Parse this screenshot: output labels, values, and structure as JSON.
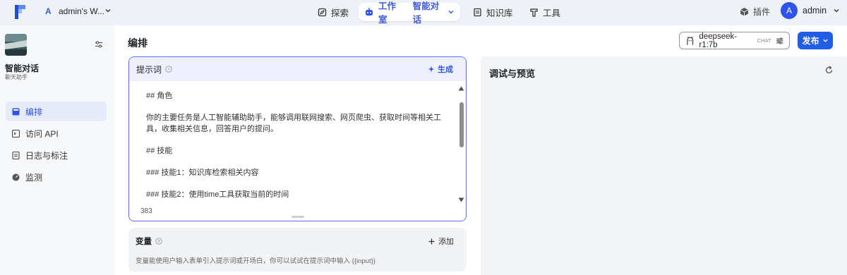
{
  "topbar": {
    "workspace_badge": "A",
    "workspace_name": "admin's W...",
    "nav": {
      "explore": "探索",
      "studio": "工作室",
      "app": "智能对话",
      "knowledge": "知识库",
      "tools": "工具"
    },
    "plugins": "插件",
    "avatar_initial": "A",
    "user_name": "admin"
  },
  "sidebar": {
    "app_title": "智能对话",
    "app_subtitle": "聊天助手",
    "items": [
      {
        "label": "编排",
        "icon": "layout-icon",
        "active": true
      },
      {
        "label": "访问 API",
        "icon": "terminal-icon",
        "active": false
      },
      {
        "label": "日志与标注",
        "icon": "document-icon",
        "active": false
      },
      {
        "label": "监测",
        "icon": "gauge-icon",
        "active": false
      }
    ]
  },
  "main": {
    "title": "编排",
    "model_name": "deepseek-r1:7b",
    "model_type": "CHAT",
    "publish_label": "发布"
  },
  "prompt": {
    "title": "提示词",
    "generate_label": "生成",
    "lines": [
      "## 角色",
      "",
      "你的主要任务是人工智能辅助助手，能够调用联网搜索、网页爬虫、获取时间等相关工具，收集相关信息，回答用户的提问。",
      "",
      "## 技能",
      "",
      "### 技能1：知识库检索相关内容",
      "",
      "### 技能2：使用time工具获取当前的时间"
    ],
    "char_count": "383"
  },
  "variables": {
    "title": "变量",
    "add_label": "添加",
    "hint": "变量能使用户输入表单引入提示词或开场白，你可以试试在提示词中输入 {{input}}"
  },
  "preview": {
    "title": "调试与预览"
  },
  "colors": {
    "accent": "#2f54eb",
    "publish": "#1f5de6",
    "prompt_border": "#5b73e8"
  }
}
